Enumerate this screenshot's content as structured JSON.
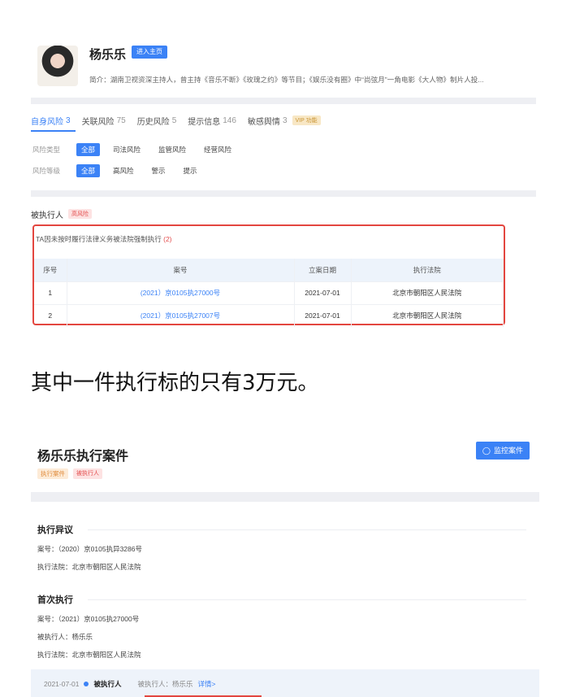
{
  "profile": {
    "name": "杨乐乐",
    "home_button": "进入主页",
    "intro": "简介：湖南卫视资深主持人，曾主持《音乐不断》《玫瑰之约》等节目；《娱乐没有圈》中“尚弦月”一角电影《大人物》制片人投..."
  },
  "tabs": [
    {
      "label": "自身风险",
      "count": "3"
    },
    {
      "label": "关联风险",
      "count": "75"
    },
    {
      "label": "历史风险",
      "count": "5"
    },
    {
      "label": "提示信息",
      "count": "146"
    },
    {
      "label": "敏感舆情",
      "count": "3"
    }
  ],
  "vip_badge": "VIP 功能",
  "filters": {
    "type_label": "风险类型",
    "type_options": [
      "全部",
      "司法风险",
      "监管风险",
      "经营风险"
    ],
    "level_label": "风险等级",
    "level_options": [
      "全部",
      "高风险",
      "警示",
      "提示"
    ]
  },
  "section": {
    "title": "被执行人",
    "tag": "高风险"
  },
  "executed": {
    "desc_prefix": "TA因未按时履行法律义务被法院强制执行",
    "count": "(2)",
    "headers": [
      "序号",
      "案号",
      "立案日期",
      "执行法院"
    ],
    "rows": [
      [
        "1",
        "(2021）京0105执27000号",
        "2021-07-01",
        "北京市朝阳区人民法院"
      ],
      [
        "2",
        "(2021）京0105执27007号",
        "2021-07-01",
        "北京市朝阳区人民法院"
      ]
    ]
  },
  "caption": "其中一件执行标的只有3万元。",
  "case_detail": {
    "title": "杨乐乐执行案件",
    "monitor_button": "监控案件",
    "tags": [
      "执行案件",
      "被执行人"
    ],
    "objection": {
      "title": "执行异议",
      "case_no": "案号：（2020）京0105执异3286号",
      "court": "执行法院：北京市朝阳区人民法院"
    },
    "first": {
      "title": "首次执行",
      "case_no": "案号：（2021）京0105执27000号",
      "person": "被执行人：杨乐乐",
      "court": "执行法院：北京市朝阳区人民法院"
    },
    "timeline": {
      "date": "2021-07-01",
      "label": "被执行人",
      "person": "被执行人：杨乐乐",
      "link": "详情>"
    }
  }
}
